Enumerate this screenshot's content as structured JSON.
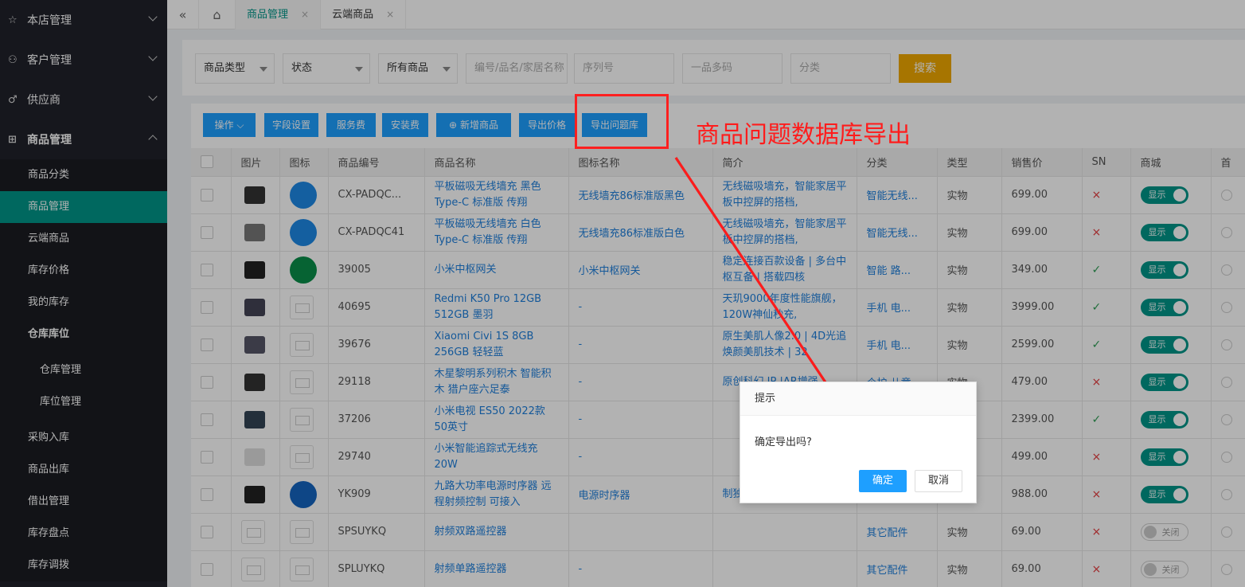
{
  "sidebar": {
    "groups": [
      {
        "icon": "star-icon",
        "label": "本店管理"
      },
      {
        "icon": "user-icon",
        "label": "客户管理"
      },
      {
        "icon": "male-icon",
        "label": "供应商"
      },
      {
        "icon": "gift-icon",
        "label": "商品管理"
      }
    ],
    "sub_items": [
      "商品分类",
      "商品管理",
      "云端商品",
      "库存价格",
      "我的库存",
      "仓库库位",
      "仓库管理",
      "库位管理",
      "采购入库",
      "商品出库",
      "借出管理",
      "库存盘点",
      "库存调拨"
    ]
  },
  "topbar": {
    "collapse_glyph": "«",
    "home_glyph": "⌂",
    "tabs": [
      {
        "label": "商品管理",
        "close": "×"
      },
      {
        "label": "云端商品",
        "close": "×"
      }
    ]
  },
  "filters": {
    "type": "商品类型",
    "status": "状态",
    "all": "所有商品",
    "keyword_placeholder": "编号/品名/家居名称",
    "serial_placeholder": "序列号",
    "multi_code_placeholder": "一品多码",
    "category_placeholder": "分类",
    "search_label": "搜索"
  },
  "toolbar": {
    "operate": "操作",
    "field_settings": "字段设置",
    "service_fee": "服务费",
    "install_fee": "安装费",
    "add_product": "新增商品",
    "export_price": "导出价格",
    "export_problem": "导出问题库"
  },
  "table": {
    "headers": [
      "图片",
      "图标",
      "商品编号",
      "商品名称",
      "图标名称",
      "简介",
      "分类",
      "类型",
      "销售价",
      "SN",
      "商城",
      "首"
    ],
    "rows": [
      {
        "code": "CX-PADQC...",
        "name": "平板磁吸无线墙充 黑色 Type-C 标准版 传翔",
        "icon_name": "无线墙充86标准版黑色",
        "intro": "无线磁吸墙充，智能家居平板中控屏的搭档,",
        "cat": "智能无线...",
        "type": "实物",
        "price": "699.00",
        "sn": "×",
        "mall": "显示"
      },
      {
        "code": "CX-PADQC41",
        "name": "平板磁吸无线墙充 白色 Type-C 标准版 传翔",
        "icon_name": "无线墙充86标准版白色",
        "intro": "无线磁吸墙充，智能家居平板中控屏的搭档,",
        "cat": "智能无线...",
        "type": "实物",
        "price": "699.00",
        "sn": "×",
        "mall": "显示"
      },
      {
        "code": "39005",
        "name": "小米中枢网关",
        "icon_name": "小米中枢网关",
        "intro": "稳定连接百款设备 | 多台中枢互备 | 搭载四核",
        "cat": "智能 路...",
        "type": "实物",
        "price": "349.00",
        "sn": "✓",
        "mall": "显示"
      },
      {
        "code": "40695",
        "name": "Redmi K50 Pro 12GB 512GB 墨羽",
        "icon_name": "-",
        "intro": "天玑9000年度性能旗舰，120W神仙秒充,",
        "cat": "手机 电...",
        "type": "实物",
        "price": "3999.00",
        "sn": "✓",
        "mall": "显示"
      },
      {
        "code": "39676",
        "name": "Xiaomi Civi 1S 8GB 256GB 轻轻蓝",
        "icon_name": "-",
        "intro": "原生美肌人像2.0 | 4D光追焕颜美肌技术 | 32",
        "cat": "手机 电...",
        "type": "实物",
        "price": "2599.00",
        "sn": "✓",
        "mall": "显示"
      },
      {
        "code": "29118",
        "name": "木星黎明系列积木 智能积木 猎户座六足泰",
        "icon_name": "-",
        "intro": "原创科幻 IP |AR增强",
        "cat": "个护 儿童",
        "type": "实物",
        "price": "479.00",
        "sn": "×",
        "mall": "显示"
      },
      {
        "code": "37206",
        "name": "小米电视 ES50 2022款 50英寸",
        "icon_name": "-",
        "intro": "",
        "cat": "",
        "type": "物",
        "price": "2399.00",
        "sn": "✓",
        "mall": "显示"
      },
      {
        "code": "29740",
        "name": "小米智能追踪式无线充 20W",
        "icon_name": "-",
        "intro": "",
        "cat": "",
        "type": "物",
        "price": "499.00",
        "sn": "×",
        "mall": "显示"
      },
      {
        "code": "YK909",
        "name": "九路大功率电源时序器 远程射频控制 可接入",
        "icon_name": "电源时序器",
        "intro": "制独立开关控制，可",
        "cat": "",
        "type": "物",
        "price": "988.00",
        "sn": "×",
        "mall": "显示"
      },
      {
        "code": "SPSUYKQ",
        "name": "射频双路遥控器",
        "icon_name": "",
        "intro": "",
        "cat": "其它配件",
        "type": "实物",
        "price": "69.00",
        "sn": "×",
        "mall": "关闭"
      },
      {
        "code": "SPLUYKQ",
        "name": "射频单路遥控器",
        "icon_name": "-",
        "intro": "",
        "cat": "其它配件",
        "type": "实物",
        "price": "69.00",
        "sn": "×",
        "mall": "关闭"
      }
    ]
  },
  "dialog": {
    "title": "提示",
    "message": "确定导出吗?",
    "ok": "确定",
    "cancel": "取消"
  },
  "annotation": {
    "text": "商品问题数据库导出",
    "color": "#ff1c1c"
  },
  "colors": {
    "sidebar_bg": "#20222a",
    "active": "#009688",
    "primary": "#1e9fff",
    "search": "#f0a800"
  }
}
